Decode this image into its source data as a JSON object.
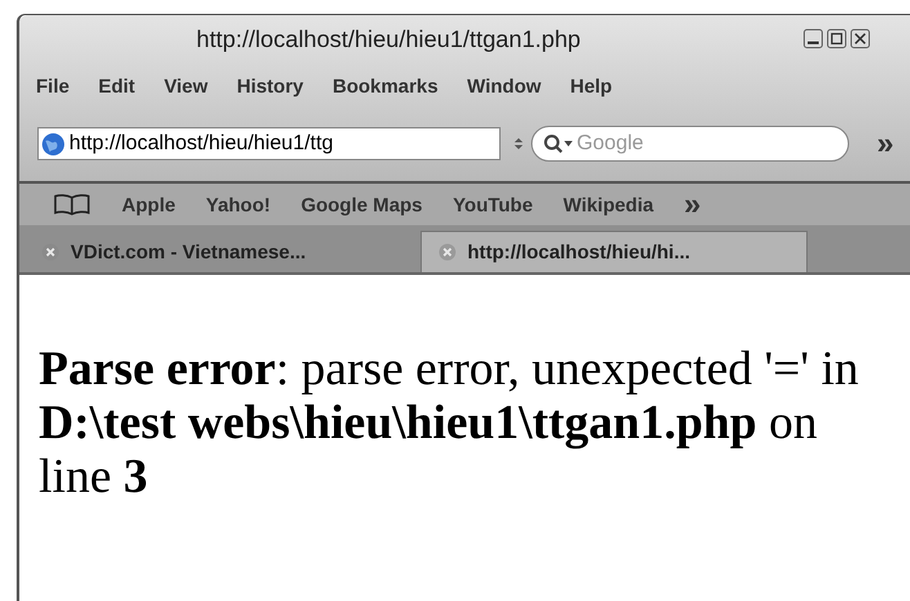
{
  "window": {
    "title": "http://localhost/hieu/hieu1/ttgan1.php"
  },
  "menu": [
    "File",
    "Edit",
    "View",
    "History",
    "Bookmarks",
    "Window",
    "Help"
  ],
  "address": {
    "value": "http://localhost/hieu/hieu1/ttg"
  },
  "search": {
    "placeholder": "Google"
  },
  "toolbar_overflow": "»",
  "bookmarks": [
    "Apple",
    "Yahoo!",
    "Google Maps",
    "YouTube",
    "Wikipedia"
  ],
  "bookmarks_overflow": "»",
  "tabs": [
    {
      "label": "VDict.com - Vietnamese...",
      "selected": false
    },
    {
      "label": "http://localhost/hieu/hi...",
      "selected": true
    }
  ],
  "content": {
    "message": "**Parse error**: parse error, unexpected '=' in **D:\\test webs\\hieu\\hieu1\\ttgan1.php** on line **3**"
  }
}
